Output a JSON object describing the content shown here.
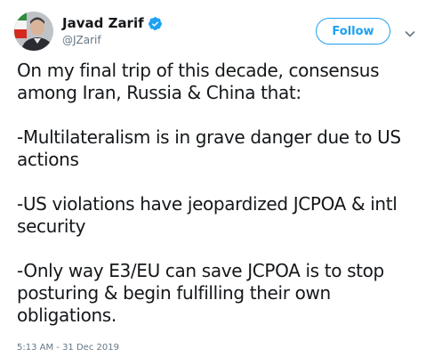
{
  "author": {
    "display_name": "Javad Zarif",
    "handle": "@JZarif",
    "verified": true,
    "avatar_icon": "profile-photo"
  },
  "actions": {
    "follow_label": "Follow",
    "menu_icon": "chevron-down-icon"
  },
  "tweet": {
    "paragraphs": [
      "On my final trip of this decade, consensus among Iran, Russia & China that:",
      "-Multilateralism is in grave danger due to US actions",
      "-US violations have jeopardized JCPOA & intl security",
      "-Only way E3/EU can save JCPOA is to stop posturing & begin fulfilling their own obligations."
    ],
    "timestamp": "5:13 AM - 31 Dec 2019"
  },
  "colors": {
    "brand_blue": "#1da1f2",
    "text_primary": "#14171a",
    "text_secondary": "#657786"
  }
}
